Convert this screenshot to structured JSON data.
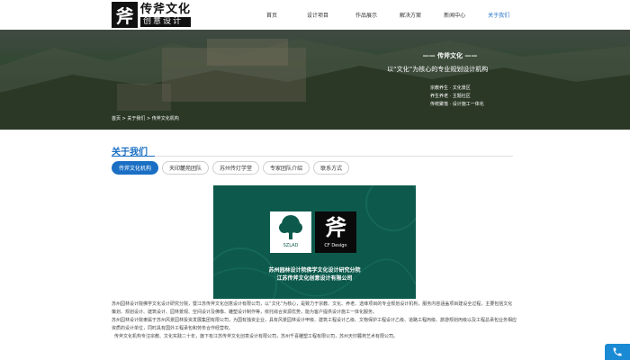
{
  "header": {
    "logo_mark": "斧",
    "logo_title": "传斧文化",
    "logo_subtitle": "创意设计",
    "nav": [
      {
        "label": "首页",
        "active": false
      },
      {
        "label": "设计项目",
        "active": false
      },
      {
        "label": "作品展示",
        "active": false
      },
      {
        "label": "解决方案",
        "active": false
      },
      {
        "label": "新闻中心",
        "active": false
      },
      {
        "label": "关于我们",
        "active": true
      }
    ]
  },
  "banner": {
    "title": "—— 传斧文化 ——",
    "slogan": "以“文化”为核心的专业规划设计机构",
    "list": [
      "宗教养生 · 文化景区",
      "养生养老 · 主题社区",
      "传统聚落 · 设计施工一体化"
    ],
    "breadcrumb": "首页 > 关于我们 > 传斧文化机构"
  },
  "section": {
    "title": "关于我们",
    "tabs": [
      {
        "label": "传斧文化机构",
        "active": true
      },
      {
        "label": "天印麓苑团队",
        "active": false
      },
      {
        "label": "苏州传灯学堂",
        "active": false
      },
      {
        "label": "专家团队介绍",
        "active": false
      },
      {
        "label": "联系方式",
        "active": false
      }
    ]
  },
  "card": {
    "left_caption": "SZLAD",
    "right_mark": "斧",
    "right_caption": "CF Design",
    "line1": "苏州园林设计院佛学文化设计研究分院",
    "line2": "江苏传斧文化创意设计有限公司"
  },
  "body": {
    "p1": "苏州园林设计院佛学文化设计研究分院，暨江苏传斧文化创意设计有限公司，以“文化”为核心，是致力于宗教、文化、养老、选绛项目的专业规划设计机构，服务内容涵盖项目建设全过程，主要包括文化策划、规划设计、建筑设计、园林景观、空间设计及佛像、雕塑设计制作等，依托综合资源优势，能为客户提供设计施工一体化服务。",
    "p2": "苏州园林设计院隶属于苏州风景园林投资发展集团有限公司，为国有独资企业，具有风景园林设计甲级、建筑工程设计乙级、文物保护工程设计乙级、道路工程丙级、旅游规划丙级以及工程总承包业务相应资质的设计单位，同时具有国外工程承包和劳务合作经营权。",
    "p3": "传斧文化机构专注宗教、文化实践二十年，旗下有江苏传斧文化创意设计有限公司，苏州千喜雕塑工程有限公司，苏州天印麓苑艺术有限公司。"
  },
  "float_widget": {
    "icon": "phone-icon"
  },
  "colors": {
    "accent": "#1a6fc4",
    "card_bg": "#0d5a4c"
  }
}
